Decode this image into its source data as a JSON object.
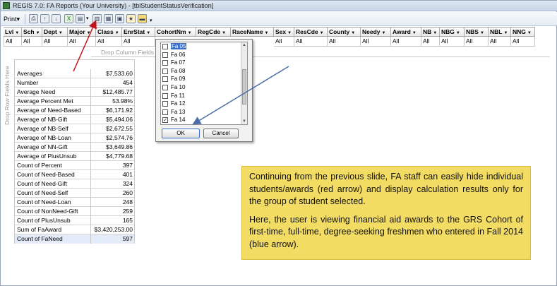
{
  "window": {
    "title": "REGIS 7.0: FA Reports (Your University) - [tblStudentStatusVerification]"
  },
  "toolbar": {
    "print_label": "Print",
    "icons": [
      "print-icon",
      "preview-icon",
      "sort-ascending-icon",
      "sort-descending-icon",
      "excel-icon",
      "export-icon",
      "filter-icon",
      "grid-icon",
      "layout-icon",
      "refresh-icon",
      "folder-icon"
    ]
  },
  "filter_columns": [
    {
      "name": "Lvl",
      "value": "All"
    },
    {
      "name": "Sch",
      "value": "All"
    },
    {
      "name": "Dept",
      "value": "All"
    },
    {
      "name": "Major",
      "value": "All"
    },
    {
      "name": "Class",
      "value": "All"
    },
    {
      "name": "EnrStat",
      "value": "All"
    },
    {
      "name": "CohortNm",
      "value": ""
    },
    {
      "name": "RegCde",
      "value": ""
    },
    {
      "name": "RaceName",
      "value": ""
    },
    {
      "name": "Sex",
      "value": "All"
    },
    {
      "name": "ResCde",
      "value": "All"
    },
    {
      "name": "County",
      "value": "All"
    },
    {
      "name": "Needy",
      "value": "All"
    },
    {
      "name": "Award",
      "value": "All"
    },
    {
      "name": "NB",
      "value": "All"
    },
    {
      "name": "NBG",
      "value": "All"
    },
    {
      "name": "NBS",
      "value": "All"
    },
    {
      "name": "NBL",
      "value": "All"
    },
    {
      "name": "NNG",
      "value": "All"
    }
  ],
  "drop_zones": {
    "column": "Drop Column Fields Here",
    "row": "Drop Row Fields Here"
  },
  "summary_rows": [
    {
      "label": "Averages",
      "value": "$7,533.60"
    },
    {
      "label": "Number",
      "value": "454"
    },
    {
      "label": "Average Need",
      "value": "$12,485.77"
    },
    {
      "label": "Average Percent Met",
      "value": "53.98%"
    },
    {
      "label": "Average of Need-Based",
      "value": "$6,171.92"
    },
    {
      "label": "Average of NB-Gift",
      "value": "$5,494.06"
    },
    {
      "label": "Average of NB-Self",
      "value": "$2,672.55"
    },
    {
      "label": "Average of NB-Loan",
      "value": "$2,574.76"
    },
    {
      "label": "Average of NN-Gift",
      "value": "$3,649.86"
    },
    {
      "label": "Average of PlusUnsub",
      "value": "$4,779.68"
    },
    {
      "label": "Count of Percent",
      "value": "397"
    },
    {
      "label": "Count of Need-Based",
      "value": "401"
    },
    {
      "label": "Count of Need-Gift",
      "value": "324"
    },
    {
      "label": "Count of Need-Self",
      "value": "260"
    },
    {
      "label": "Count of Need-Loan",
      "value": "248"
    },
    {
      "label": "Count of NonNeed-Gift",
      "value": "259"
    },
    {
      "label": "Count of PlusUnsub",
      "value": "165"
    },
    {
      "label": "Sum of FaAward",
      "value": "$3,420,253.00"
    },
    {
      "label": "Count of FaNeed",
      "value": "597"
    }
  ],
  "cohort_popup": {
    "items": [
      {
        "label": "Fa 05",
        "checked": false
      },
      {
        "label": "Fa 06",
        "checked": false
      },
      {
        "label": "Fa 07",
        "checked": false
      },
      {
        "label": "Fa 08",
        "checked": false
      },
      {
        "label": "Fa 09",
        "checked": false
      },
      {
        "label": "Fa 10",
        "checked": false
      },
      {
        "label": "Fa 11",
        "checked": false
      },
      {
        "label": "Fa 12",
        "checked": false
      },
      {
        "label": "Fa 13",
        "checked": false
      },
      {
        "label": "Fa 14",
        "checked": true
      }
    ],
    "ok_label": "OK",
    "cancel_label": "Cancel"
  },
  "note": {
    "paragraph1": "Continuing from the previous slide, FA staff can easily hide individual students/awards (red arrow) and display calculation results only for the group of student selected.",
    "paragraph2": "Here, the user is viewing financial aid awards to the GRS Cohort of first-time, full-time, degree-seeking freshmen who entered in Fall 2014  (blue arrow)."
  },
  "colors": {
    "red_arrow": "#c0141a",
    "blue_arrow": "#4a6fa8",
    "note_background": "#f3dc64",
    "selection": "#3a6fc8"
  }
}
